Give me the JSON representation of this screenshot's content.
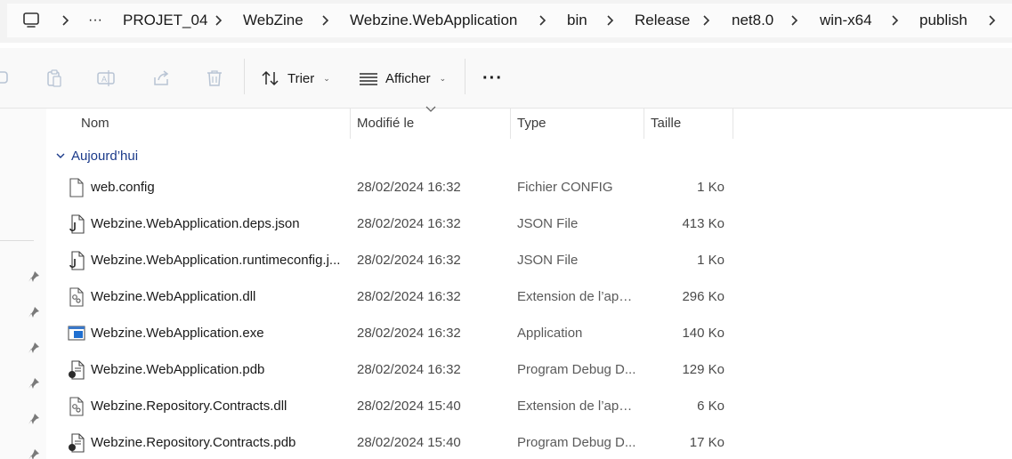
{
  "breadcrumb": {
    "overflow": "···",
    "items": [
      "PROJET_04",
      "WebZine",
      "Webzine.WebApplication",
      "bin",
      "Release",
      "net8.0",
      "win-x64",
      "publish"
    ]
  },
  "toolbar": {
    "sort_label": "Trier",
    "view_label": "Afficher",
    "more_label": "···"
  },
  "columns": {
    "name": "Nom",
    "modified": "Modifié le",
    "type": "Type",
    "size": "Taille"
  },
  "group": {
    "label": "Aujourd’hui"
  },
  "files": [
    {
      "name": "web.config",
      "date": "28/02/2024 16:32",
      "type": "Fichier CONFIG",
      "size": "1 Ko",
      "icon": "file-icon"
    },
    {
      "name": "Webzine.WebApplication.deps.json",
      "date": "28/02/2024 16:32",
      "type": "JSON File",
      "size": "413 Ko",
      "icon": "json-file-icon"
    },
    {
      "name": "Webzine.WebApplication.runtimeconfig.j...",
      "date": "28/02/2024 16:32",
      "type": "JSON File",
      "size": "1 Ko",
      "icon": "json-file-icon"
    },
    {
      "name": "Webzine.WebApplication.dll",
      "date": "28/02/2024 16:32",
      "type": "Extension de l’app...",
      "size": "296 Ko",
      "icon": "dll-file-icon"
    },
    {
      "name": "Webzine.WebApplication.exe",
      "date": "28/02/2024 16:32",
      "type": "Application",
      "size": "140 Ko",
      "icon": "exe-file-icon"
    },
    {
      "name": "Webzine.WebApplication.pdb",
      "date": "28/02/2024 16:32",
      "type": "Program Debug D...",
      "size": "129 Ko",
      "icon": "pdb-file-icon"
    },
    {
      "name": "Webzine.Repository.Contracts.dll",
      "date": "28/02/2024 15:40",
      "type": "Extension de l’app...",
      "size": "6 Ko",
      "icon": "dll-file-icon"
    },
    {
      "name": "Webzine.Repository.Contracts.pdb",
      "date": "28/02/2024 15:40",
      "type": "Program Debug D...",
      "size": "17 Ko",
      "icon": "pdb-file-icon"
    }
  ],
  "colors": {
    "group_text": "#1b3a8a",
    "exe_blue": "#1f6fd0"
  }
}
